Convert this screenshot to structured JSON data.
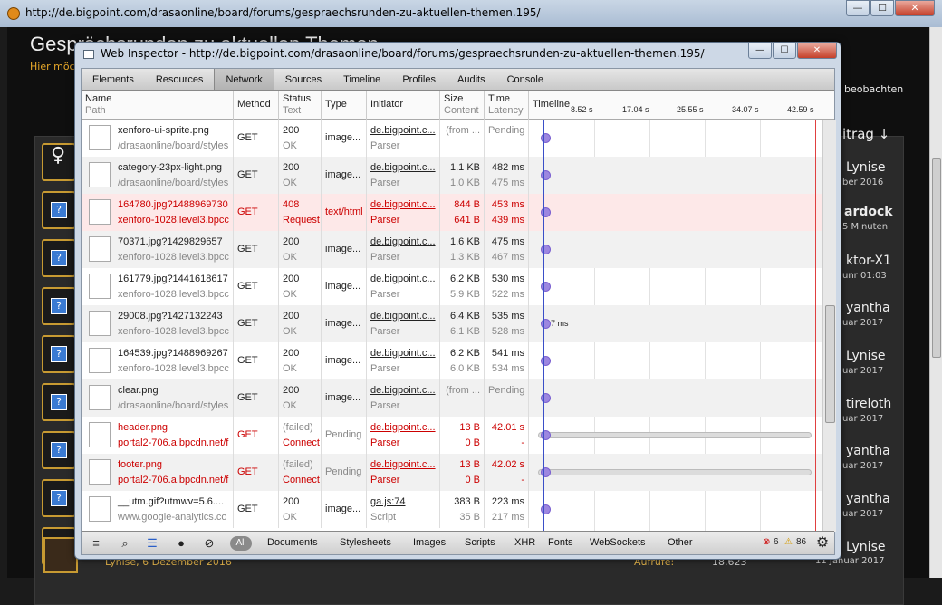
{
  "outer": {
    "address": "http://de.bigpoint.com/drasaonline/board/forums/gespraechsrunden-zu-aktuellen-themen.195/",
    "forum_title": "Gesprächsrunden zu aktuellen Themen",
    "forum_sub": "Hier möcht",
    "beobachten": "beobachten",
    "beitrag_sort": "itrag ↓",
    "right_col": [
      {
        "name": "Lynise",
        "date": "ber 2016"
      },
      {
        "name": "ardock",
        "date": "5 Minuten"
      },
      {
        "name": "ktor-X1",
        "date": "unr 01:03"
      },
      {
        "name": "yantha",
        "date": "uar 2017"
      },
      {
        "name": "Lynise",
        "date": "uar 2017"
      },
      {
        "name": "tireloth",
        "date": "uar 2017"
      },
      {
        "name": "yantha",
        "date": "uar 2017"
      },
      {
        "name": "yantha",
        "date": "uar 2017"
      },
      {
        "name": "Lynise",
        "date": "11 Januar 2017"
      }
    ],
    "bottom_user": "Lynise, 6 Dezember 2016",
    "bottom_aufrufe_label": "Aufrufe:",
    "bottom_aufrufe": "18.623"
  },
  "inspector": {
    "title": "Web Inspector - http://de.bigpoint.com/drasaonline/board/forums/gespraechsrunden-zu-aktuellen-themen.195/",
    "tabs": [
      "Elements",
      "Resources",
      "Network",
      "Sources",
      "Timeline",
      "Profiles",
      "Audits",
      "Console"
    ],
    "active_tab": "Network",
    "headers": {
      "name": "Name",
      "path": "Path",
      "method": "Method",
      "status": "Status",
      "text": "Text",
      "type": "Type",
      "initiator": "Initiator",
      "size": "Size",
      "content": "Content",
      "time": "Time",
      "latency": "Latency",
      "timeline": "Timeline"
    },
    "ticks": [
      "8.52 s",
      "17.04 s",
      "25.55 s",
      "34.07 s",
      "42.59 s"
    ],
    "rows": [
      {
        "name": "xenforo-ui-sprite.png",
        "path": "/drasaonline/board/styles",
        "method": "GET",
        "status": "200",
        "text": "OK",
        "type": "image...",
        "initiator": "de.bigpoint.c...",
        "init_sub": "Parser",
        "size": "(from ...",
        "content": "",
        "time": "Pending",
        "latency": "",
        "err": false
      },
      {
        "name": "category-23px-light.png",
        "path": "/drasaonline/board/styles",
        "method": "GET",
        "status": "200",
        "text": "OK",
        "type": "image...",
        "initiator": "de.bigpoint.c...",
        "init_sub": "Parser",
        "size": "1.1 KB",
        "content": "1.0 KB",
        "time": "482 ms",
        "latency": "475 ms",
        "err": false
      },
      {
        "name": "164780.jpg?1488969730",
        "path": "xenforo-1028.level3.bpcc",
        "method": "GET",
        "status": "408",
        "text": "Request",
        "type": "text/html",
        "initiator": "de.bigpoint.c...",
        "init_sub": "Parser",
        "size": "844 B",
        "content": "641 B",
        "time": "453 ms",
        "latency": "439 ms",
        "err": true
      },
      {
        "name": "70371.jpg?1429829657",
        "path": "xenforo-1028.level3.bpcc",
        "method": "GET",
        "status": "200",
        "text": "OK",
        "type": "image...",
        "initiator": "de.bigpoint.c...",
        "init_sub": "Parser",
        "size": "1.6 KB",
        "content": "1.3 KB",
        "time": "475 ms",
        "latency": "467 ms",
        "err": false
      },
      {
        "name": "161779.jpg?1441618617",
        "path": "xenforo-1028.level3.bpcc",
        "method": "GET",
        "status": "200",
        "text": "OK",
        "type": "image...",
        "initiator": "de.bigpoint.c...",
        "init_sub": "Parser",
        "size": "6.2 KB",
        "content": "5.9 KB",
        "time": "530 ms",
        "latency": "522 ms",
        "err": false
      },
      {
        "name": "29008.jpg?1427132243",
        "path": "xenforo-1028.level3.bpcc",
        "method": "GET",
        "status": "200",
        "text": "OK",
        "type": "image...",
        "initiator": "de.bigpoint.c...",
        "init_sub": "Parser",
        "size": "6.4 KB",
        "content": "6.1 KB",
        "time": "535 ms",
        "latency": "528 ms",
        "err": false,
        "label": "7 ms"
      },
      {
        "name": "164539.jpg?1488969267",
        "path": "xenforo-1028.level3.bpcc",
        "method": "GET",
        "status": "200",
        "text": "OK",
        "type": "image...",
        "initiator": "de.bigpoint.c...",
        "init_sub": "Parser",
        "size": "6.2 KB",
        "content": "6.0 KB",
        "time": "541 ms",
        "latency": "534 ms",
        "err": false
      },
      {
        "name": "clear.png",
        "path": "/drasaonline/board/styles",
        "method": "GET",
        "status": "200",
        "text": "OK",
        "type": "image...",
        "initiator": "de.bigpoint.c...",
        "init_sub": "Parser",
        "size": "(from ...",
        "content": "",
        "time": "Pending",
        "latency": "",
        "err": false
      },
      {
        "name": "header.png",
        "path": "portal2-706.a.bpcdn.net/f",
        "method": "GET",
        "status": "(failed)",
        "text": "Connect",
        "type": "Pending",
        "initiator": "de.bigpoint.c...",
        "init_sub": "Parser",
        "size": "13 B",
        "content": "0 B",
        "time": "42.01 s",
        "latency": "-",
        "err": true,
        "pending": true
      },
      {
        "name": "footer.png",
        "path": "portal2-706.a.bpcdn.net/f",
        "method": "GET",
        "status": "(failed)",
        "text": "Connect",
        "type": "Pending",
        "initiator": "de.bigpoint.c...",
        "init_sub": "Parser",
        "size": "13 B",
        "content": "0 B",
        "time": "42.02 s",
        "latency": "-",
        "err": true,
        "pending": true
      },
      {
        "name": "__utm.gif?utmwv=5.6....",
        "path": "www.google-analytics.co",
        "method": "GET",
        "status": "200",
        "text": "OK",
        "type": "image...",
        "initiator": "ga.js:74",
        "init_sub": "Script",
        "size": "383 B",
        "content": "35 B",
        "time": "223 ms",
        "latency": "217 ms",
        "err": false
      }
    ],
    "filters": [
      "All",
      "Documents",
      "Stylesheets",
      "Images",
      "Scripts",
      "XHR",
      "Fonts",
      "WebSockets",
      "Other"
    ],
    "errors": "6",
    "warnings": "86",
    "colors": {
      "error": "#cc0000",
      "dot": "#9c86e0",
      "blue_line": "#3a4fc8",
      "red_line": "#e04040"
    }
  }
}
